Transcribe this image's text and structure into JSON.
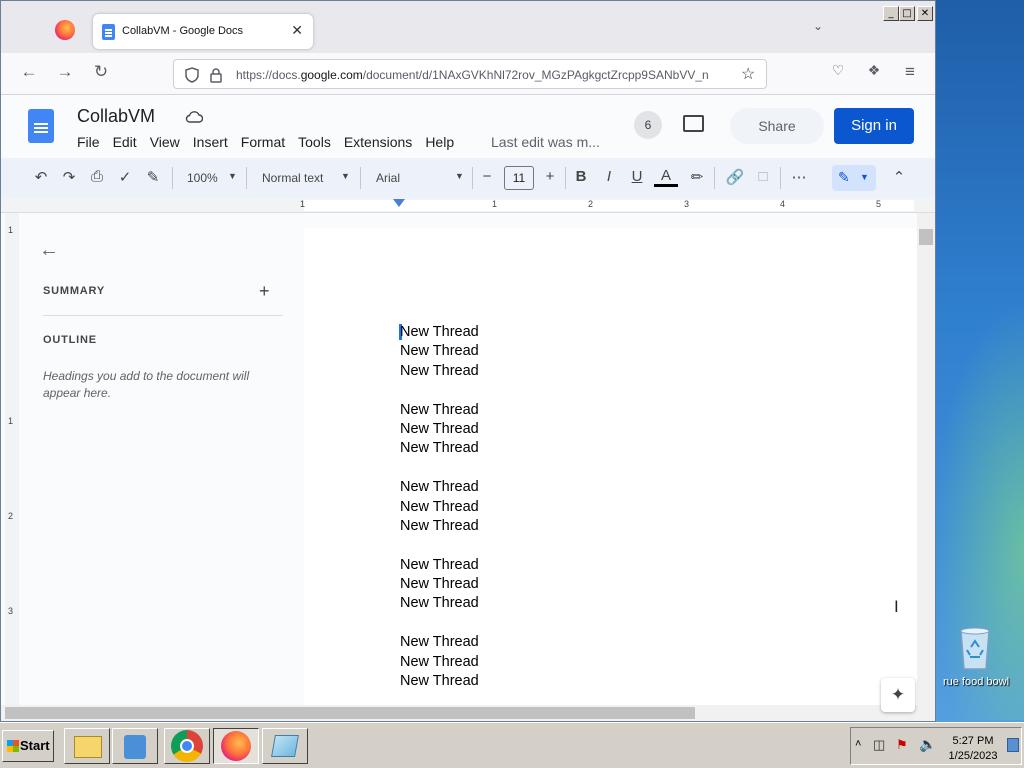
{
  "browser": {
    "tab_title": "CollabVM - Google Docs",
    "tab_close": "✕",
    "url_prefix": "https://docs.",
    "url_domain": "google.com",
    "url_rest": "/document/d/1NAxGVKhNl72rov_MGzPAgkgctZrcpp9SANbVV_n"
  },
  "docs": {
    "title": "CollabVM",
    "menus": [
      "File",
      "Edit",
      "View",
      "Insert",
      "Format",
      "Tools",
      "Extensions",
      "Help"
    ],
    "last_edit": "Last edit was m...",
    "collaborator_count": "6",
    "share_label": "Share",
    "signin_label": "Sign in"
  },
  "toolbar": {
    "zoom": "100%",
    "style": "Normal text",
    "font": "Arial",
    "font_size": "11",
    "bold": "B",
    "italic": "I",
    "underline": "U",
    "text_color": "A"
  },
  "ruler": {
    "marks": [
      "1",
      "1",
      "2",
      "3",
      "4",
      "5"
    ],
    "vertical_marks": [
      "1",
      "1",
      "2",
      "3"
    ]
  },
  "outline_panel": {
    "summary_label": "SUMMARY",
    "outline_label": "OUTLINE",
    "hint": "Headings you add to the document will appear here."
  },
  "document": {
    "lines": [
      "New Thread",
      "New Thread",
      "New Thread",
      "",
      "New Thread",
      "New Thread",
      "New Thread",
      "",
      "New Thread",
      "New Thread",
      "New Thread",
      "",
      "New Thread",
      "New Thread",
      "New Thread",
      "",
      "New Thread",
      "New Thread",
      "New Thread"
    ]
  },
  "desktop": {
    "recycle_bin_label": "rue food bowl"
  },
  "taskbar": {
    "start_label": "Start",
    "time": "5:27 PM",
    "date": "1/25/2023"
  },
  "colors": {
    "docs_blue": "#0b57d0",
    "accent": "#4285f4"
  }
}
